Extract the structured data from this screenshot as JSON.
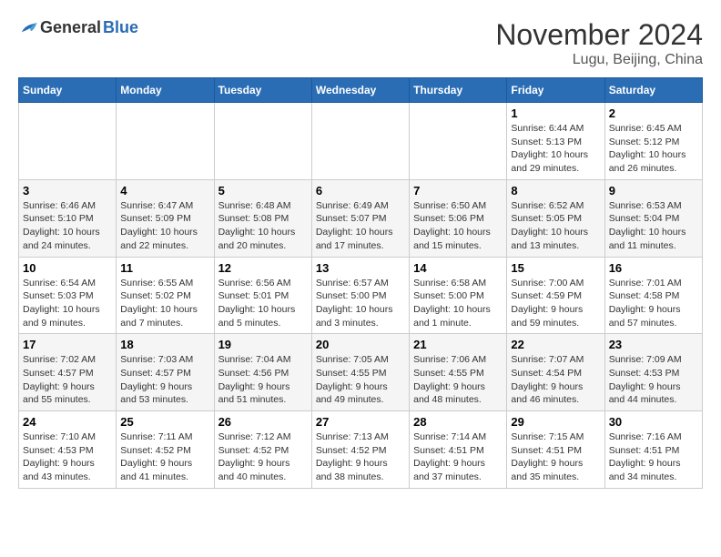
{
  "logo": {
    "general": "General",
    "blue": "Blue"
  },
  "title": "November 2024",
  "location": "Lugu, Beijing, China",
  "weekdays": [
    "Sunday",
    "Monday",
    "Tuesday",
    "Wednesday",
    "Thursday",
    "Friday",
    "Saturday"
  ],
  "weeks": [
    [
      {
        "day": "",
        "info": ""
      },
      {
        "day": "",
        "info": ""
      },
      {
        "day": "",
        "info": ""
      },
      {
        "day": "",
        "info": ""
      },
      {
        "day": "",
        "info": ""
      },
      {
        "day": "1",
        "info": "Sunrise: 6:44 AM\nSunset: 5:13 PM\nDaylight: 10 hours and 29 minutes."
      },
      {
        "day": "2",
        "info": "Sunrise: 6:45 AM\nSunset: 5:12 PM\nDaylight: 10 hours and 26 minutes."
      }
    ],
    [
      {
        "day": "3",
        "info": "Sunrise: 6:46 AM\nSunset: 5:10 PM\nDaylight: 10 hours and 24 minutes."
      },
      {
        "day": "4",
        "info": "Sunrise: 6:47 AM\nSunset: 5:09 PM\nDaylight: 10 hours and 22 minutes."
      },
      {
        "day": "5",
        "info": "Sunrise: 6:48 AM\nSunset: 5:08 PM\nDaylight: 10 hours and 20 minutes."
      },
      {
        "day": "6",
        "info": "Sunrise: 6:49 AM\nSunset: 5:07 PM\nDaylight: 10 hours and 17 minutes."
      },
      {
        "day": "7",
        "info": "Sunrise: 6:50 AM\nSunset: 5:06 PM\nDaylight: 10 hours and 15 minutes."
      },
      {
        "day": "8",
        "info": "Sunrise: 6:52 AM\nSunset: 5:05 PM\nDaylight: 10 hours and 13 minutes."
      },
      {
        "day": "9",
        "info": "Sunrise: 6:53 AM\nSunset: 5:04 PM\nDaylight: 10 hours and 11 minutes."
      }
    ],
    [
      {
        "day": "10",
        "info": "Sunrise: 6:54 AM\nSunset: 5:03 PM\nDaylight: 10 hours and 9 minutes."
      },
      {
        "day": "11",
        "info": "Sunrise: 6:55 AM\nSunset: 5:02 PM\nDaylight: 10 hours and 7 minutes."
      },
      {
        "day": "12",
        "info": "Sunrise: 6:56 AM\nSunset: 5:01 PM\nDaylight: 10 hours and 5 minutes."
      },
      {
        "day": "13",
        "info": "Sunrise: 6:57 AM\nSunset: 5:00 PM\nDaylight: 10 hours and 3 minutes."
      },
      {
        "day": "14",
        "info": "Sunrise: 6:58 AM\nSunset: 5:00 PM\nDaylight: 10 hours and 1 minute."
      },
      {
        "day": "15",
        "info": "Sunrise: 7:00 AM\nSunset: 4:59 PM\nDaylight: 9 hours and 59 minutes."
      },
      {
        "day": "16",
        "info": "Sunrise: 7:01 AM\nSunset: 4:58 PM\nDaylight: 9 hours and 57 minutes."
      }
    ],
    [
      {
        "day": "17",
        "info": "Sunrise: 7:02 AM\nSunset: 4:57 PM\nDaylight: 9 hours and 55 minutes."
      },
      {
        "day": "18",
        "info": "Sunrise: 7:03 AM\nSunset: 4:57 PM\nDaylight: 9 hours and 53 minutes."
      },
      {
        "day": "19",
        "info": "Sunrise: 7:04 AM\nSunset: 4:56 PM\nDaylight: 9 hours and 51 minutes."
      },
      {
        "day": "20",
        "info": "Sunrise: 7:05 AM\nSunset: 4:55 PM\nDaylight: 9 hours and 49 minutes."
      },
      {
        "day": "21",
        "info": "Sunrise: 7:06 AM\nSunset: 4:55 PM\nDaylight: 9 hours and 48 minutes."
      },
      {
        "day": "22",
        "info": "Sunrise: 7:07 AM\nSunset: 4:54 PM\nDaylight: 9 hours and 46 minutes."
      },
      {
        "day": "23",
        "info": "Sunrise: 7:09 AM\nSunset: 4:53 PM\nDaylight: 9 hours and 44 minutes."
      }
    ],
    [
      {
        "day": "24",
        "info": "Sunrise: 7:10 AM\nSunset: 4:53 PM\nDaylight: 9 hours and 43 minutes."
      },
      {
        "day": "25",
        "info": "Sunrise: 7:11 AM\nSunset: 4:52 PM\nDaylight: 9 hours and 41 minutes."
      },
      {
        "day": "26",
        "info": "Sunrise: 7:12 AM\nSunset: 4:52 PM\nDaylight: 9 hours and 40 minutes."
      },
      {
        "day": "27",
        "info": "Sunrise: 7:13 AM\nSunset: 4:52 PM\nDaylight: 9 hours and 38 minutes."
      },
      {
        "day": "28",
        "info": "Sunrise: 7:14 AM\nSunset: 4:51 PM\nDaylight: 9 hours and 37 minutes."
      },
      {
        "day": "29",
        "info": "Sunrise: 7:15 AM\nSunset: 4:51 PM\nDaylight: 9 hours and 35 minutes."
      },
      {
        "day": "30",
        "info": "Sunrise: 7:16 AM\nSunset: 4:51 PM\nDaylight: 9 hours and 34 minutes."
      }
    ]
  ]
}
